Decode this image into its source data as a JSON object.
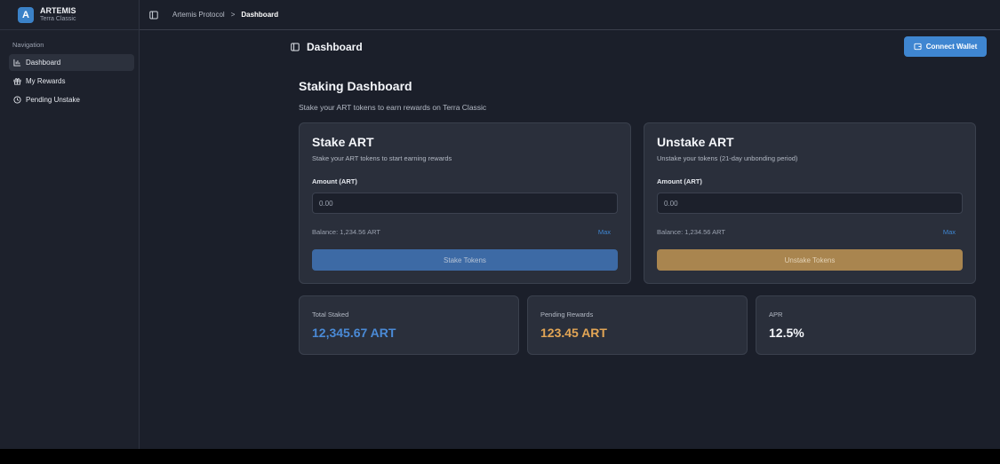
{
  "brand": {
    "logo_letter": "A",
    "title": "ARTEMIS",
    "subtitle": "Terra Classic"
  },
  "sidebar": {
    "heading": "Navigation",
    "items": [
      {
        "label": "Dashboard",
        "icon": "bar-chart-icon",
        "active": true
      },
      {
        "label": "My Rewards",
        "icon": "gift-icon",
        "active": false
      },
      {
        "label": "Pending Unstake",
        "icon": "clock-icon",
        "active": false
      }
    ]
  },
  "topbar": {
    "breadcrumb": {
      "root": "Artemis Protocol",
      "separator": ">",
      "current": "Dashboard"
    }
  },
  "header": {
    "title": "Dashboard",
    "connect_label": "Connect Wallet"
  },
  "page": {
    "title": "Staking Dashboard",
    "subtitle": "Stake your ART tokens to earn rewards on Terra Classic"
  },
  "stake_card": {
    "title": "Stake ART",
    "subtitle": "Stake your ART tokens to start earning rewards",
    "amount_label": "Amount (ART)",
    "amount_placeholder": "0.00",
    "balance": "Balance: 1,234.56 ART",
    "max_label": "Max",
    "button_label": "Stake Tokens"
  },
  "unstake_card": {
    "title": "Unstake ART",
    "subtitle": "Unstake your tokens (21-day unbonding period)",
    "amount_label": "Amount (ART)",
    "amount_placeholder": "0.00",
    "balance": "Balance: 1,234.56 ART",
    "max_label": "Max",
    "button_label": "Unstake Tokens"
  },
  "stats": [
    {
      "label": "Total Staked",
      "value": "12,345.67 ART",
      "color": "#4a8ad6"
    },
    {
      "label": "Pending Rewards",
      "value": "123.45 ART",
      "color": "#e2a555"
    },
    {
      "label": "APR",
      "value": "12.5%",
      "color": "#f4f6fa"
    }
  ],
  "colors": {
    "accent": "#3f86d1",
    "stake_button": "#3d6aa5",
    "unstake_button": "#a9854f",
    "background": "#1b1f2a",
    "card": "#2a2f3b"
  }
}
